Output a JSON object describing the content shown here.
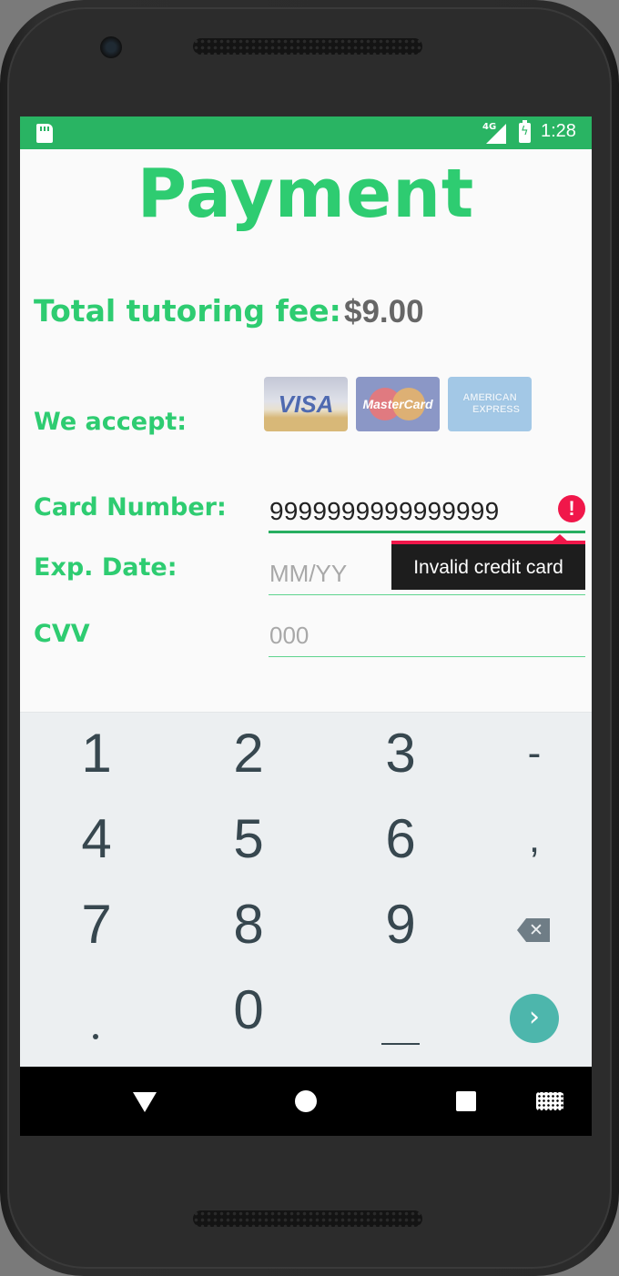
{
  "status_bar": {
    "network": "4G",
    "time": "1:28"
  },
  "header": {
    "title": "Payment"
  },
  "fee": {
    "label": "Total tutoring fee:",
    "value": "$9.00"
  },
  "accept": {
    "label": "We accept:",
    "cards": [
      {
        "name": "VISA",
        "icon": "visa-card-icon"
      },
      {
        "name": "MasterCard",
        "icon": "mastercard-card-icon"
      },
      {
        "name_line1": "AMERICAN",
        "name_line2": "EXPRESS",
        "icon": "amex-card-icon"
      }
    ]
  },
  "form": {
    "card_number": {
      "label": "Card Number:",
      "value": "9999999999999999",
      "error": "Invalid credit card"
    },
    "exp_date": {
      "label": "Exp. Date:",
      "placeholder": "MM/YY"
    },
    "cvv": {
      "label": "CVV",
      "placeholder": "000"
    }
  },
  "keyboard": {
    "rows": [
      [
        "1",
        "2",
        "3",
        "-"
      ],
      [
        "4",
        "5",
        "6",
        ","
      ],
      [
        "7",
        "8",
        "9",
        "backspace"
      ],
      [
        ".",
        "0",
        "space",
        "go"
      ]
    ],
    "go_symbol": "›"
  },
  "colors": {
    "accent": "#2ecc71",
    "status_bar": "#29b463",
    "error": "#f0174a",
    "go_key": "#4db6ac"
  }
}
